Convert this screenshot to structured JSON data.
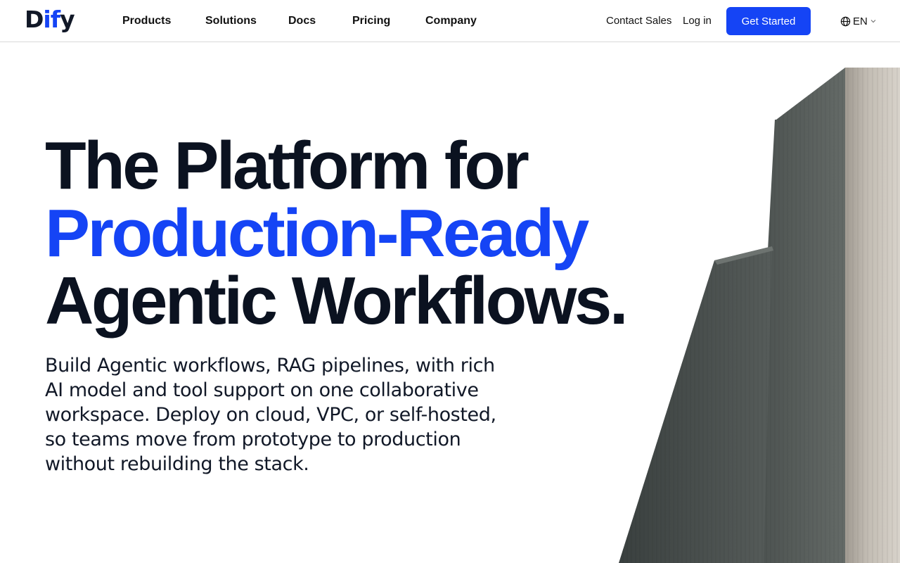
{
  "brand": {
    "logo_parts": [
      "D",
      "if",
      "y"
    ],
    "accent_color": "#1544f5",
    "text_color": "#0b1220"
  },
  "nav": {
    "items": [
      {
        "label": "Products"
      },
      {
        "label": "Solutions"
      },
      {
        "label": "Docs"
      },
      {
        "label": "Pricing"
      },
      {
        "label": "Company"
      }
    ]
  },
  "header_actions": {
    "contact_sales": "Contact Sales",
    "login": "Log in",
    "get_started": "Get Started",
    "language": "EN",
    "language_icon": "globe-icon"
  },
  "hero": {
    "title_line1": "The Platform for",
    "title_line2": "Production-Ready",
    "title_line3": "Agentic Workflows.",
    "description": "Build Agentic workflows, RAG pipelines, with rich AI model and tool support on one collaborative workspace. Deploy on cloud, VPC, or self-hosted, so teams move from prototype to production without rebuilding the stack."
  }
}
